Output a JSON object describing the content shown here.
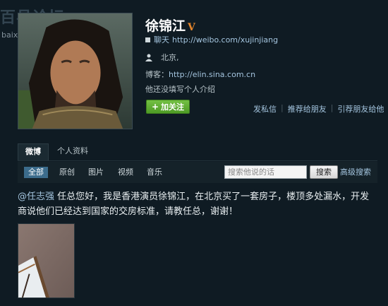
{
  "watermark": {
    "line1": "百县论坛",
    "line2": "baixianbbs.com"
  },
  "profile": {
    "name": "徐锦江",
    "verified_badge": "V",
    "weibo_label": "聊天",
    "weibo_url": "http://weibo.com/xujinjiang",
    "location": "北京,",
    "blog_label": "博客：",
    "blog_url": "http://elin.sina.com.cn",
    "intro": "他还没填写个人介绍",
    "follow_button": "加关注",
    "actions": [
      "发私信",
      "推荐给朋友",
      "引荐朋友给他"
    ]
  },
  "tabs": [
    {
      "label": "微博",
      "active": true
    },
    {
      "label": "个人资料",
      "active": false
    }
  ],
  "filters": [
    "全部",
    "原创",
    "图片",
    "视频",
    "音乐"
  ],
  "search": {
    "placeholder": "搜索他说的话",
    "button": "搜索",
    "advanced": "高级搜索"
  },
  "post": {
    "mention": "@任志强",
    "text": " 任总您好，我是香港演员徐锦江，在北京买了一套房子，楼顶多处漏水，开发商说他们已经达到国家的交房标准，请教任总，谢谢！"
  },
  "icons": {
    "verified": "verified-v-icon",
    "weibo": "square-icon",
    "location": "person-icon",
    "follow": "plus-icon"
  },
  "colors": {
    "background": "#0f1b23",
    "link": "#a4c5df",
    "follow_green": "#5aaa2e",
    "verified_orange": "#e5862b",
    "active_filter": "#3c6c8c"
  }
}
